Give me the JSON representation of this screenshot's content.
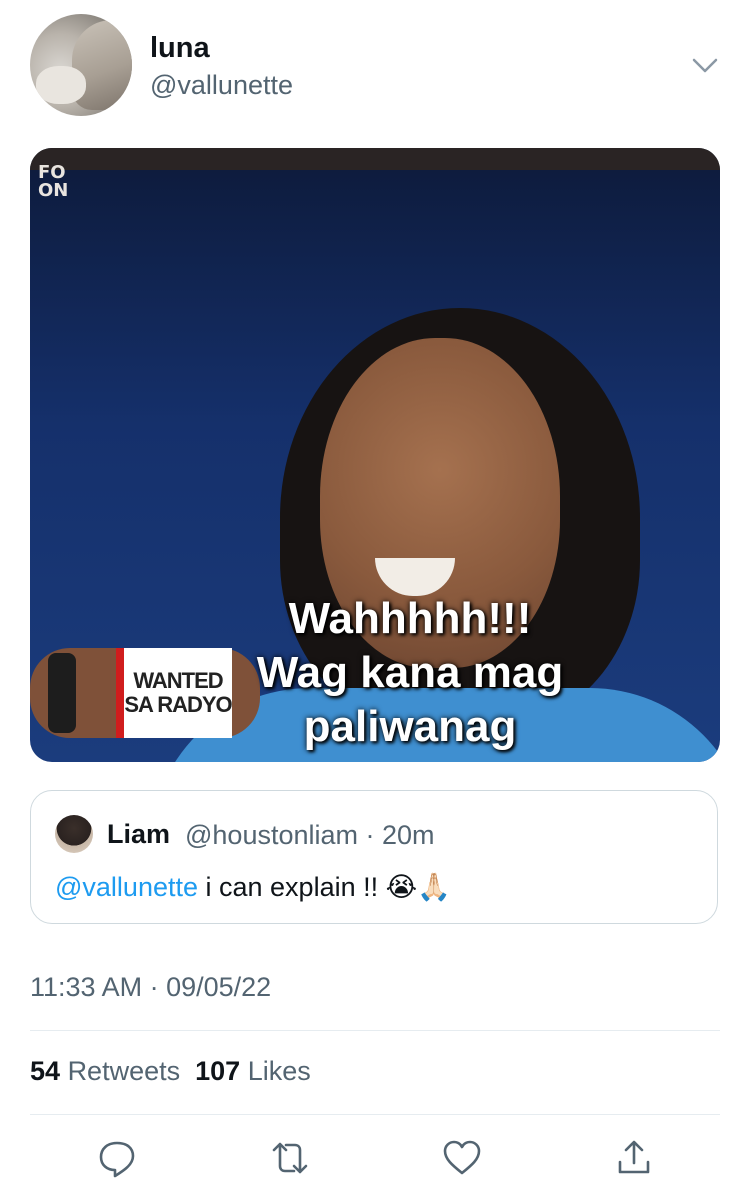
{
  "tweet": {
    "author_name": "luna",
    "author_handle": "@vallunette",
    "media_caption": [
      "Wahhhhh!!!",
      "Wag kana mag",
      "paliwanag"
    ],
    "media_badge": [
      "WANTED",
      "SA RADYO"
    ],
    "media_logo": [
      "FO",
      "ON"
    ],
    "timestamp": "11:33 AM · 09/05/22"
  },
  "quoted": {
    "name": "Liam",
    "meta": "@houstonliam · 20m",
    "mention": "@vallunette",
    "text": " i can explain !! 😭🙏🏻"
  },
  "stats": {
    "retweets_count": "54",
    "retweets_label": "Retweets",
    "likes_count": "107",
    "likes_label": "Likes"
  },
  "actions": [
    {
      "icon": "reply-icon"
    },
    {
      "icon": "retweet-icon"
    },
    {
      "icon": "like-icon"
    },
    {
      "icon": "share-icon"
    }
  ],
  "colors": {
    "accent": "#1d9bf0",
    "muted": "#536471",
    "text": "#0f1419"
  }
}
